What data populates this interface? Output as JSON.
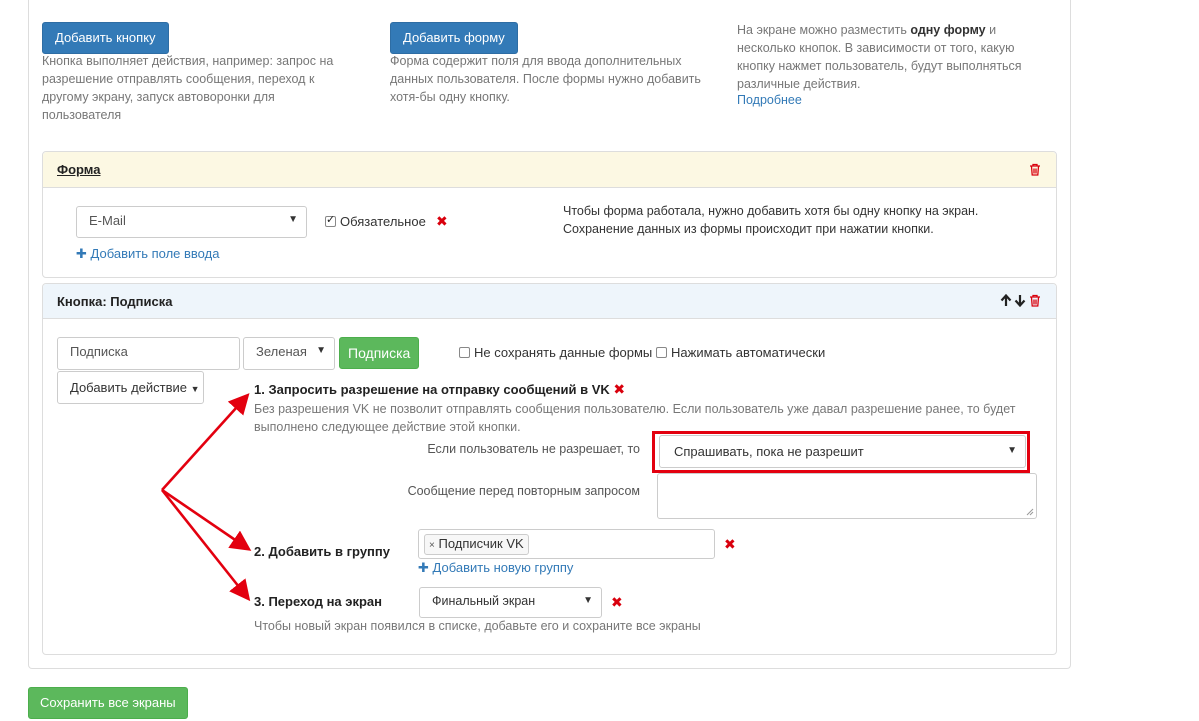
{
  "top": {
    "add_button_label": "Добавить кнопку",
    "add_button_help": "Кнопка выполняет действия, например: запрос на разрешение отправлять сообщения, переход к другому экрану, запуск автоворонки для пользователя",
    "add_form_label": "Добавить форму",
    "add_form_help": "Форма содержит поля для ввода дополнительных данных пользователя. После формы нужно добавить хотя-бы одну кнопку.",
    "info_prefix": "На экране можно разместить ",
    "info_bold": "одну форму",
    "info_suffix": " и несколько кнопок. В зависимости от того, какую кнопку нажмет пользователь, будут выполняться различные действия.",
    "more_link": "Подробнее"
  },
  "form_panel": {
    "title": "Форма",
    "field_select": "E-Mail",
    "required_label": "Обязательное",
    "required_checked": true,
    "add_field_link": "Добавить поле ввода",
    "note_line1": "Чтобы форма работала, нужно добавить хотя бы одну кнопку на экран.",
    "note_line2": "Сохранение данных из формы происходит при нажатии кнопки."
  },
  "button_panel": {
    "title": "Кнопка: Подписка",
    "button_text_value": "Подписка",
    "color_select": "Зеленая",
    "preview_button": "Подписка",
    "no_save_label": "Не сохранять данные формы",
    "auto_press_label": "Нажимать автоматически",
    "add_action_label": "Добавить действие",
    "action1": {
      "title": "1. Запросить разрешение на отправку сообщений в VK",
      "desc": "Без разрешения VK не позволит отправлять сообщения пользователю. Если пользователь уже давал разрешение ранее, то будет выполнено следующее действие этой кнопки.",
      "if_denied_label": "Если пользователь не разрешает, то",
      "if_denied_value": "Спрашивать, пока не разрешит",
      "repeat_msg_label": "Сообщение перед повторным запросом",
      "repeat_msg_value": ""
    },
    "action2": {
      "title": "2. Добавить в группу",
      "tag": "Подписчик VK",
      "add_group_link": "Добавить новую группу"
    },
    "action3": {
      "title": "3. Переход на экран",
      "screen_select": "Финальный экран",
      "help": "Чтобы новый экран появился в списке, добавьте его и сохраните все экраны"
    }
  },
  "save_all_label": "Сохранить все экраны",
  "colors": {
    "primary": "#337ab7",
    "success": "#5cb85c",
    "danger": "#d9000d",
    "form_heading_bg": "#fcf8e3",
    "button_heading_bg": "#eef5fb",
    "annotation_red": "#e3000f"
  },
  "icons": [
    "trash-icon",
    "arrow-up-icon",
    "arrow-down-icon",
    "plus-icon",
    "remove-icon",
    "caret-down-icon",
    "checkbox-icon"
  ]
}
